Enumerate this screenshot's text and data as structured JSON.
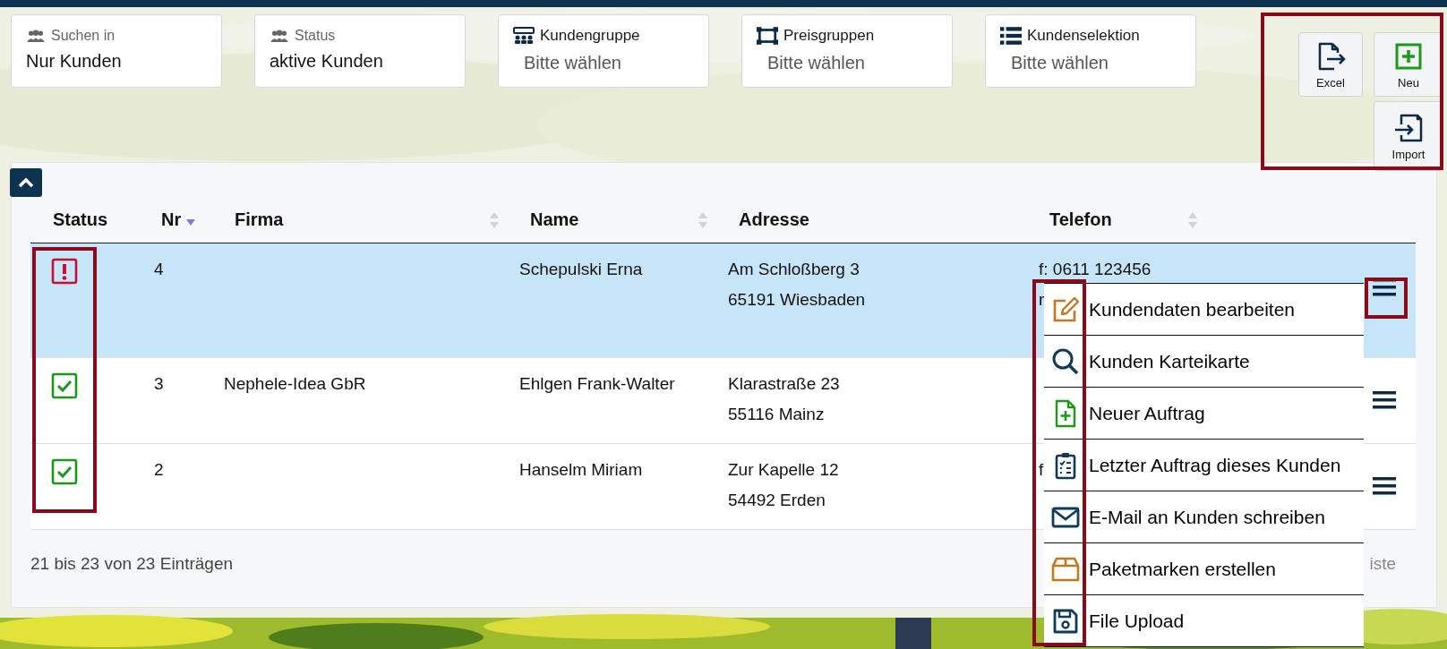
{
  "filters": [
    {
      "label": "Suchen in",
      "value": "Nur Kunden"
    },
    {
      "label": "Status",
      "value": "aktive Kunden"
    },
    {
      "label": "Kundengruppe",
      "placeholder": "Bitte wählen"
    },
    {
      "label": "Preisgruppen",
      "placeholder": "Bitte wählen"
    },
    {
      "label": "Kundenselektion",
      "placeholder": "Bitte wählen"
    }
  ],
  "actions": [
    {
      "label": "Excel"
    },
    {
      "label": "Neu"
    },
    {
      "label": "Import"
    }
  ],
  "table": {
    "columns": [
      {
        "label": "Status",
        "sortable": false
      },
      {
        "label": "Nr",
        "sortable": true,
        "sorted_descending": true
      },
      {
        "label": "Firma",
        "sortable": true,
        "sorted_descending": false
      },
      {
        "label": "Name",
        "sortable": true,
        "sorted_descending": false
      },
      {
        "label": "Adresse",
        "sortable": false
      },
      {
        "label": "Telefon",
        "sortable": true,
        "sorted_descending": false
      }
    ],
    "rows": [
      {
        "selected": true,
        "status_ok": false,
        "nr": "4",
        "name": "Schepulski Erna",
        "address": [
          "Am Schloßberg 3",
          "65191 Wiesbaden"
        ],
        "phone": [
          "f: 0611 123456",
          "r"
        ]
      },
      {
        "selected": false,
        "status_ok": true,
        "nr": "3",
        "firma": "Nephele-Idea GbR",
        "name": "Ehlgen Frank-Walter",
        "address": [
          "Klarastraße 23",
          "55116 Mainz"
        ]
      },
      {
        "selected": false,
        "status_ok": true,
        "nr": "2",
        "name": "Hanselm Miriam",
        "address": [
          "Zur Kapelle 12",
          "54492 Erden"
        ],
        "phone": [
          "f"
        ]
      }
    ]
  },
  "footer": {
    "info": "21 bis 23 von 23 Einträgen",
    "pagination": "iste"
  },
  "context_menu": {
    "items": [
      {
        "label": "Kundendaten bearbeiten"
      },
      {
        "label": "Kunden Karteikarte"
      },
      {
        "label": "Neuer Auftrag"
      },
      {
        "label": "Letzter Auftrag dieses Kunden"
      },
      {
        "label": "E-Mail an Kunden schreiben"
      },
      {
        "label": "Paketmarken erstellen"
      },
      {
        "label": "File Upload"
      }
    ]
  }
}
